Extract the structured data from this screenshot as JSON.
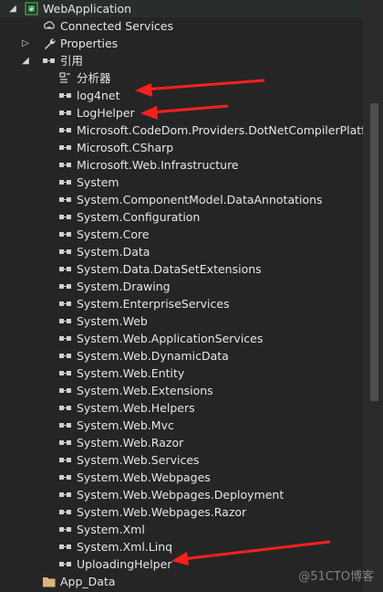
{
  "tree": {
    "project": "WebApplication",
    "connected_services": "Connected Services",
    "properties": "Properties",
    "references_folder": "引用",
    "analyzers": "分析器",
    "references": [
      "log4net",
      "LogHelper",
      "Microsoft.CodeDom.Providers.DotNetCompilerPlatfor",
      "Microsoft.CSharp",
      "Microsoft.Web.Infrastructure",
      "System",
      "System.ComponentModel.DataAnnotations",
      "System.Configuration",
      "System.Core",
      "System.Data",
      "System.Data.DataSetExtensions",
      "System.Drawing",
      "System.EnterpriseServices",
      "System.Web",
      "System.Web.ApplicationServices",
      "System.Web.DynamicData",
      "System.Web.Entity",
      "System.Web.Extensions",
      "System.Web.Helpers",
      "System.Web.Mvc",
      "System.Web.Razor",
      "System.Web.Services",
      "System.Web.Webpages",
      "System.Web.Webpages.Deployment",
      "System.Web.Webpages.Razor",
      "System.Xml",
      "System.Xml.Linq",
      "UploadingHelper"
    ],
    "app_data": "App_Data"
  },
  "watermark": "@51CTO博客",
  "colors": {
    "background": "#252526",
    "text": "#e6e6e6",
    "annotation_arrow": "#ff1f1f"
  },
  "icons": {
    "project": "csharp-project-icon",
    "connected_services": "cloud-link-icon",
    "properties": "wrench-icon",
    "references_folder": "reference-icon",
    "analyzers": "analyzer-icon",
    "reference": "reference-icon",
    "app_data": "folder-icon"
  }
}
